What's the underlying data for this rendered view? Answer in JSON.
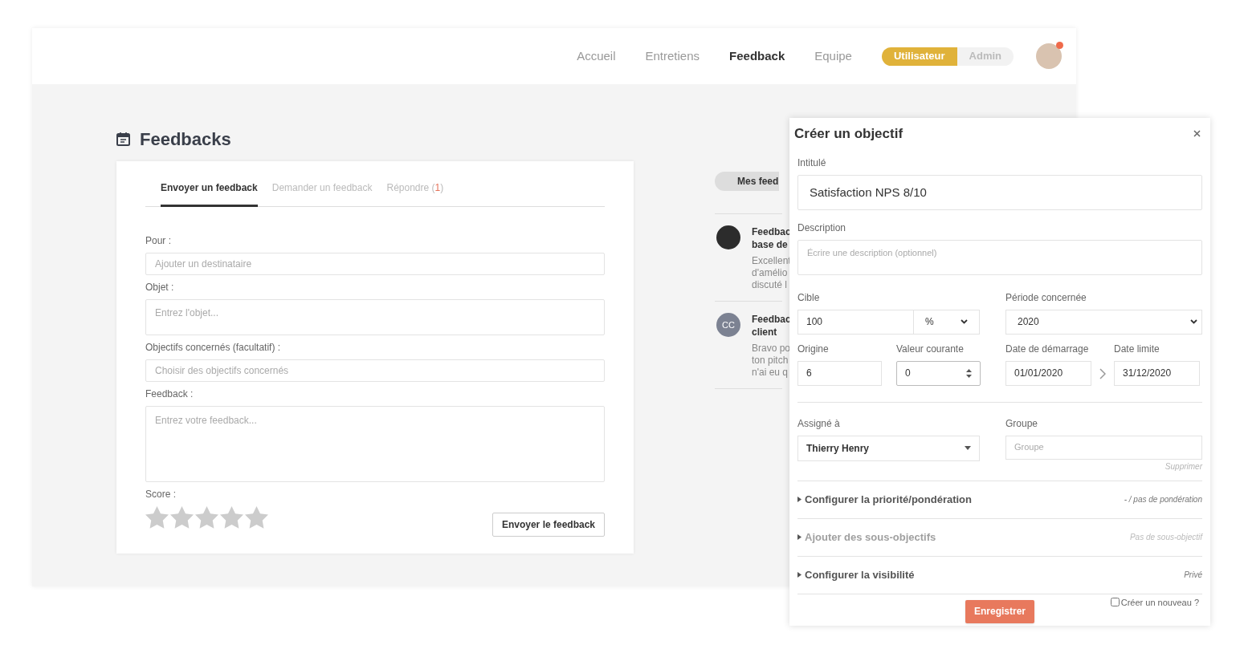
{
  "nav": {
    "items": [
      {
        "label": "Accueil",
        "selected": false
      },
      {
        "label": "Entretiens",
        "selected": false
      },
      {
        "label": "Feedback",
        "selected": true
      },
      {
        "label": "Equipe",
        "selected": false
      }
    ],
    "roles": [
      {
        "label": "Utilisateur",
        "selected": true
      },
      {
        "label": "Admin",
        "selected": false
      }
    ],
    "notification": true
  },
  "page": {
    "title": "Feedbacks"
  },
  "form": {
    "tabs": [
      {
        "label": "Envoyer un feedback",
        "selected": true
      },
      {
        "label": "Demander un feedback",
        "selected": false
      },
      {
        "label": "Répondre",
        "count": "1",
        "brackets": [
          "(",
          ")"
        ],
        "selected": false
      }
    ],
    "fields": [
      {
        "label": "Pour :",
        "placeholder": "Ajouter un destinataire",
        "kind": "input"
      },
      {
        "label": "Objet :",
        "placeholder": "Entrez l'objet...",
        "kind": "tall"
      },
      {
        "label": "Objectifs concernés (facultatif) :",
        "placeholder": "Choisir des objectifs concernés",
        "kind": "input"
      },
      {
        "label": "Feedback :",
        "placeholder": "Entrez votre feedback...",
        "kind": "textarea"
      }
    ],
    "score": {
      "label": "Score :",
      "stars": 0
    },
    "submit": "Envoyer le feedback"
  },
  "feed": {
    "tab": "Mes feed",
    "items": [
      {
        "kind": "photo",
        "title": [
          "Feedbac",
          "base de"
        ],
        "text": [
          "Excellent",
          "d'amélio",
          "discuté l"
        ]
      },
      {
        "kind": "initials",
        "initials": "CC",
        "title": [
          "Feedbac",
          "client"
        ],
        "text": [
          "Bravo po",
          "ton pitch",
          "n'ai eu q"
        ]
      }
    ]
  },
  "modal": {
    "title": "Créer un objectif",
    "intitule": {
      "label": "Intitulé",
      "value": "Satisfaction NPS 8/10"
    },
    "description": {
      "label": "Description",
      "placeholder": "Écrire une description (optionnel)"
    },
    "cible": {
      "label": "Cible",
      "value": "100",
      "unit": "%"
    },
    "periode": {
      "label": "Période concernée",
      "value": "2020"
    },
    "origine": {
      "label": "Origine",
      "value": "6"
    },
    "valeur": {
      "label": "Valeur courante",
      "value": "0"
    },
    "debut": {
      "label": "Date de démarrage",
      "value": "01/01/2020"
    },
    "fin": {
      "label": "Date limite",
      "value": "31/12/2020"
    },
    "assigne": {
      "label": "Assigné à",
      "value": "Thierry Henry"
    },
    "groupe": {
      "label": "Groupe",
      "placeholder": "Groupe",
      "remove": "Supprimer"
    },
    "sections": [
      {
        "label": "Configurer la priorité/pondération",
        "summary": "- / pas de pondération",
        "disabled": false,
        "expanded": false
      },
      {
        "label": "Ajouter des sous-objectifs",
        "summary": "Pas de sous-objectif",
        "disabled": true,
        "expanded": false
      },
      {
        "label": "Configurer la visibilité",
        "summary": "Privé",
        "disabled": false,
        "expanded": false
      }
    ],
    "save": "Enregistrer",
    "create_new": {
      "label": "Créer un nouveau ?",
      "checked": false
    }
  }
}
